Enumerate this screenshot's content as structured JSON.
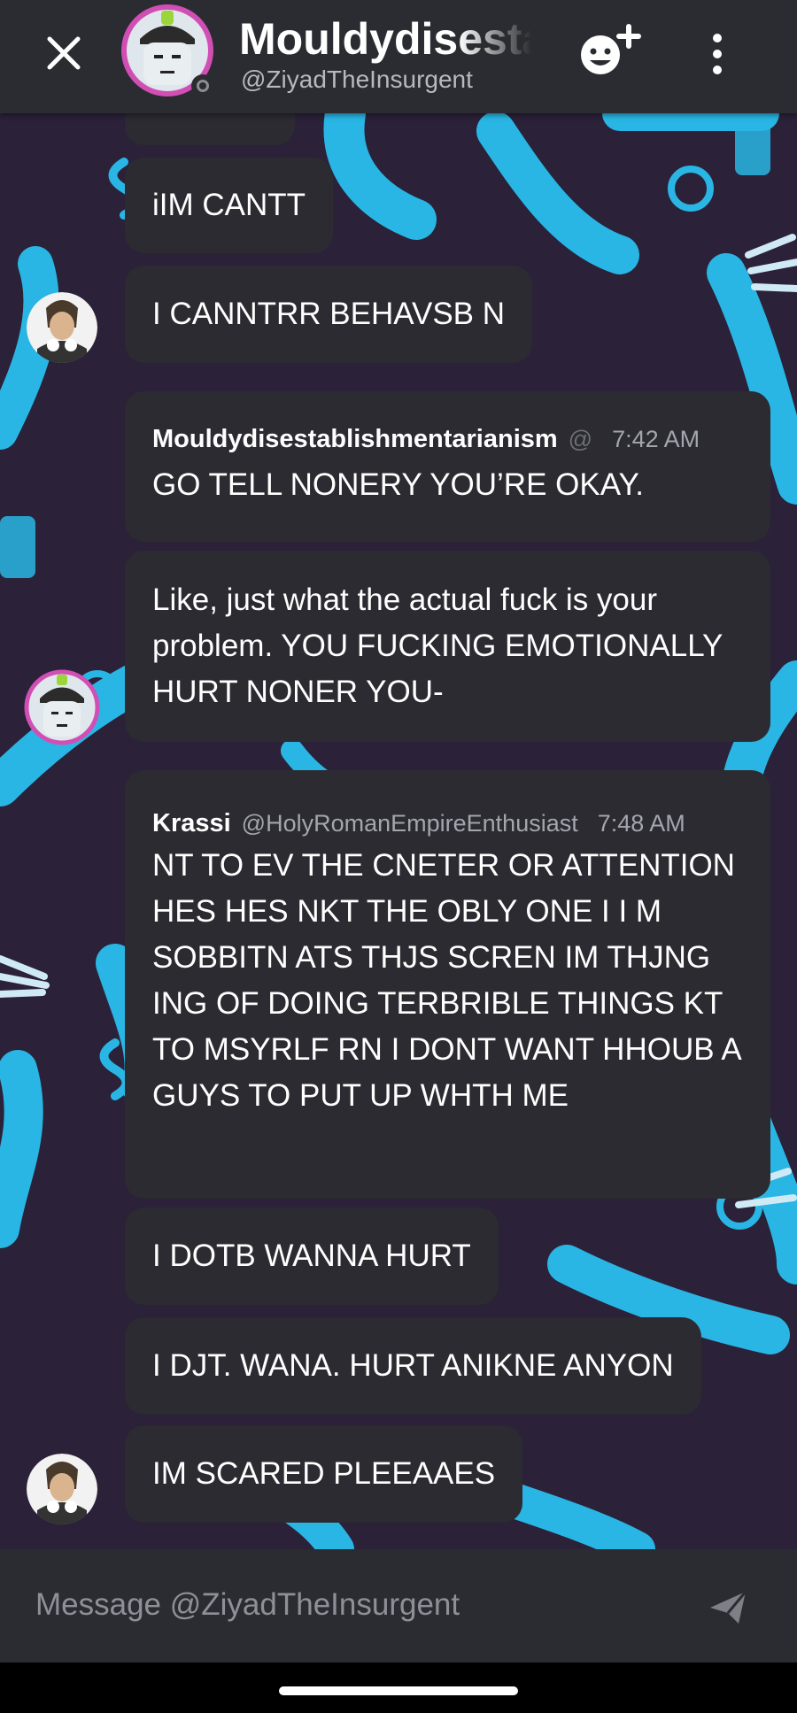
{
  "header": {
    "title": "Mouldydisestablishmentarianism",
    "subtitle": "@ZiyadTheInsurgent",
    "close_icon": "close-icon",
    "add_friend_icon": "add-friend-icon",
    "more_icon": "more-vertical-icon"
  },
  "messages": [
    {
      "text": "iIM CANTT"
    },
    {
      "text": "I CANNTRR BEHAVSB N"
    },
    {
      "author": "Mouldydisestablishmentarianism",
      "separator": "@",
      "time": "7:42 AM",
      "text": "GO TELL NONERY YOU’RE OKAY."
    },
    {
      "text": "Like, just what the actual fuck is your problem. YOU FUCKING EMOTIONALLY HURT NONER YOU-"
    },
    {
      "author": "Krassi",
      "handle": "@HolyRomanEmpireEnthusiast",
      "time": "7:48 AM",
      "text": "NT TO EV THE CNETER OR ATTENTION HES HES NKT THE OBLY ONE I I M SOBBITN ATS THJS SCREN IM THJNG ING OF DOING TERBRIBLE THINGS KT TO MSYRLF RN I DONT WANT HHOUB A GUYS TO PUT UP WHTH ME"
    },
    {
      "text": "I DOTB WANNA HURT"
    },
    {
      "text": "I DJT. WANA. HURT ANIKNE ANYON"
    },
    {
      "text": "IM SCARED PLEEAAES"
    }
  ],
  "composer": {
    "placeholder": "Message @ZiyadTheInsurgent",
    "send_icon": "send-icon"
  },
  "colors": {
    "header_bg": "#2b2c31",
    "chat_bg": "#2b2139",
    "bubble_bg": "#2b2b31",
    "accent_cyan": "#29b6e4",
    "avatar_ring": "#d14fb4"
  }
}
